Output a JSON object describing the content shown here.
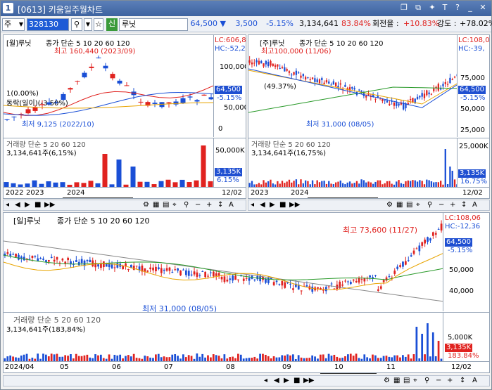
{
  "window": {
    "number": "1",
    "title": "[0613] 키움일주월차트"
  },
  "toolbar": {
    "type": "주",
    "code": "328130",
    "credit": "신",
    "name": "루닛",
    "price": "64,500",
    "change": "3,500",
    "rate": "-5.15%",
    "volume": "3,134,641",
    "ratio": "83.84%",
    "turnover_label": "회전율 :",
    "turnover": "+10.83%",
    "strength_label": "강도 :",
    "strength": "+78.02%"
  },
  "monthly": {
    "title": "[월]루닛",
    "price_label": "종가 단순 5 10 20 60 120",
    "high_note": "최고 160,440 (2023/09)",
    "low_note": "최저 9,125 (2022/10)",
    "left_note": "1(0.00%)",
    "left_note2": "동락(일이)(-3.50%)",
    "lc": "LC:606,8",
    "hc": "HC:-52,2",
    "price_ticks": [
      "100,000",
      "50,000",
      "0"
    ],
    "cur_price": "64,500",
    "cur_rate": "-5.15%",
    "vol_label": "거래량 단순 5 20 60 120",
    "vol_value": "3,134,641주(6,15%)",
    "vol_tick": "50,000K",
    "vol_cur": "3,135K",
    "vol_rate": "6.15%",
    "dates": [
      "2022",
      "2023",
      "2024",
      "12/02"
    ]
  },
  "weekly": {
    "title": "[주]루닛",
    "price_label": "종가 단순 5 10 20 60 120",
    "high_note": "최고100,000 (11/06)",
    "low_note": "최저 31,000 (08/05)",
    "left_note": "(49.37%)",
    "lc": "LC:108,0",
    "hc": "HC:-39,",
    "price_ticks": [
      "75,000",
      "50,000",
      "25,000"
    ],
    "cur_price": "64,500",
    "cur_rate": "-5.15%",
    "vol_label": "거래량 단순 5 20 60 120",
    "vol_value": "3,134,641주(16,75%)",
    "vol_tick": "25,000K",
    "vol_cur": "3,135K",
    "vol_rate": "16.75%",
    "dates": [
      "2023",
      "2024",
      "12/02"
    ]
  },
  "daily": {
    "title": "[일]루닛",
    "price_label": "종가 단순 5 10 20 60 120",
    "high_note": "최고 73,600 (11/27)",
    "low_note": "최저 31,000 (08/05)",
    "lc": "LC:108,06",
    "hc": "HC:-12,36",
    "price_ticks": [
      "50,000",
      "40,000"
    ],
    "cur_price": "64,500",
    "cur_rate": "-5.15%",
    "vol_label": "거래량 단순 5 20 60 120",
    "vol_value": "3,134,641주(183,84%)",
    "vol_tick": "5,000K",
    "vol_cur": "3,135K",
    "vol_rate": "183.84%",
    "dates": [
      "2024/04",
      "05",
      "06",
      "07",
      "08",
      "09",
      "10",
      "11",
      "12/02"
    ]
  },
  "colors": {
    "up": "#e0221f",
    "down": "#1a4fd6",
    "ma5": "#e0221f",
    "ma10": "#1a4fd6",
    "ma20": "#e8a400",
    "ma60": "#2a9a2a",
    "ma120": "#888888",
    "blue": "#1f4fd1"
  }
}
